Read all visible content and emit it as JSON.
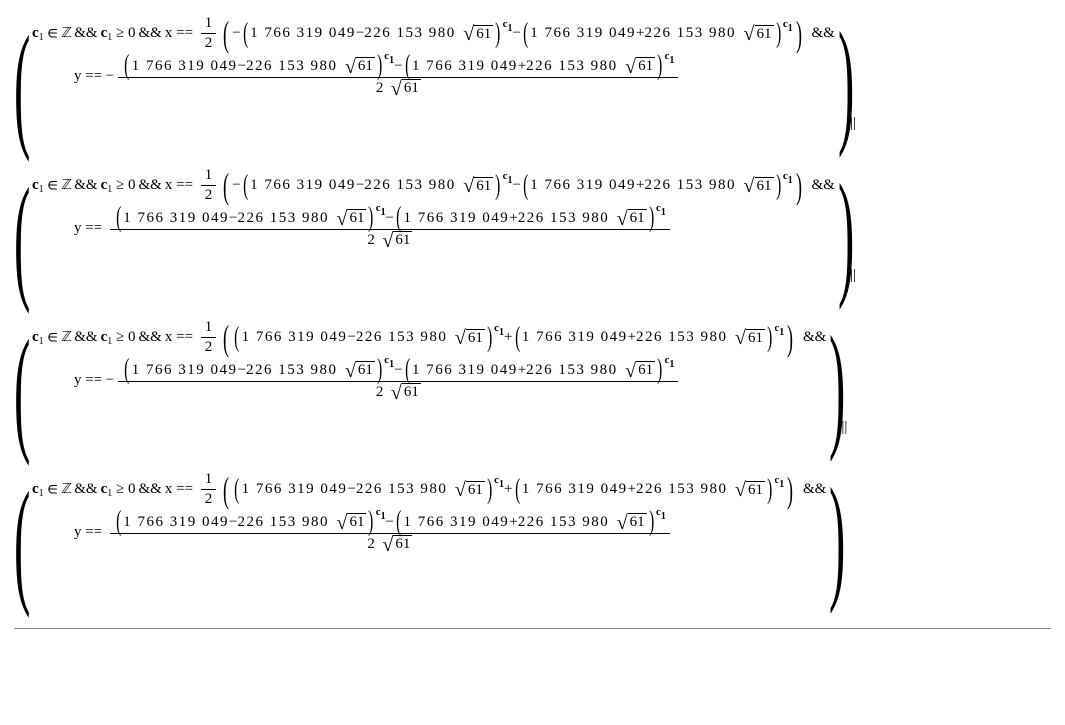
{
  "constants": {
    "integers_symbol": "ℤ",
    "element_symbol": "∈",
    "and_symbol": "&&",
    "or_symbol": "||",
    "ge_symbol": "≥",
    "eq_symbol": "==",
    "var_c": "c",
    "var_c_sub": "1",
    "var_x": "x",
    "var_y": "y",
    "zero": "0",
    "half_num": "1",
    "half_den": "2",
    "big_const_a": "1 766 319 049",
    "big_const_b": "226 153 980",
    "sqrt_arg": "61",
    "two": "2",
    "minus": "−",
    "plus": "+"
  },
  "clauses": [
    {
      "x_outer_sign_first": "−",
      "x_join_sign": "−",
      "y_leading_sign": "−"
    },
    {
      "x_outer_sign_first": "−",
      "x_join_sign": "−",
      "y_leading_sign": ""
    },
    {
      "x_outer_sign_first": "",
      "x_join_sign": "+",
      "y_leading_sign": "−"
    },
    {
      "x_outer_sign_first": "",
      "x_join_sign": "+",
      "y_leading_sign": ""
    }
  ]
}
